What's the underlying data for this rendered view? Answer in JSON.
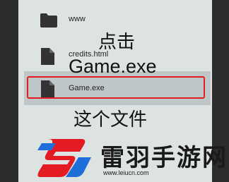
{
  "file_list": {
    "items": [
      {
        "name": "www",
        "type": "folder",
        "selected": false
      },
      {
        "name": "credits.html",
        "type": "file",
        "selected": false
      },
      {
        "name": "Game.exe",
        "type": "file",
        "selected": true
      }
    ]
  },
  "annotations": {
    "line1": "点击",
    "line2": "Game.exe",
    "line3": "这个文件",
    "highlight_color": "#e31b23"
  },
  "watermark": {
    "brand_name": "雷羽手游网",
    "url": "www.leiucn.com",
    "brand_colors": [
      "#e31b23",
      "#1e6fd9"
    ]
  }
}
